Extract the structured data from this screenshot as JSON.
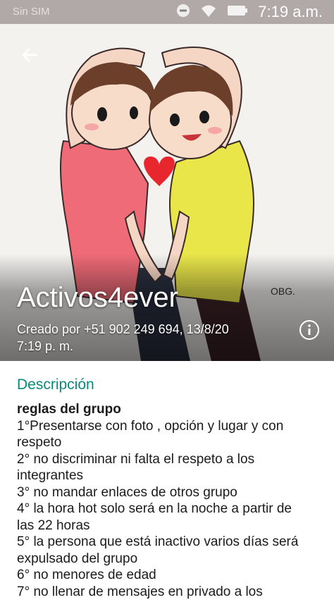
{
  "status_bar": {
    "carrier": "Sin SIM",
    "time": "7:19 a.m."
  },
  "group": {
    "name": "Activos4ever",
    "created_line1": "Creado por +51 902 249 694, 13/8/20",
    "created_line2": "7:19 p. m.",
    "artist_signature": "OBG."
  },
  "description": {
    "heading": "Descripción",
    "lines": [
      "reglas del grupo",
      "1°Presentarse con foto , opción y lugar y con",
      "respeto",
      "2° no discriminar ni falta el respeto a los",
      "integrantes",
      "3° no mandar enlaces de otros grupo",
      "4° la hora hot solo será en la noche a partir de",
      "las 22 horas",
      "5° la persona que está inactivo varios días será",
      "expulsado del grupo",
      "6° no menores de edad",
      "7° no llenar de mensajes en privado a los"
    ]
  },
  "icons": {
    "back": "arrow-back-icon",
    "info": "info-icon",
    "dnd": "do-not-disturb-icon",
    "wifi": "wifi-icon",
    "battery": "battery-icon"
  },
  "colors": {
    "accent": "#0b8a7b",
    "shirt_left": "#ef6b78",
    "shirt_right": "#e9e64a",
    "heart": "#e8262e"
  }
}
